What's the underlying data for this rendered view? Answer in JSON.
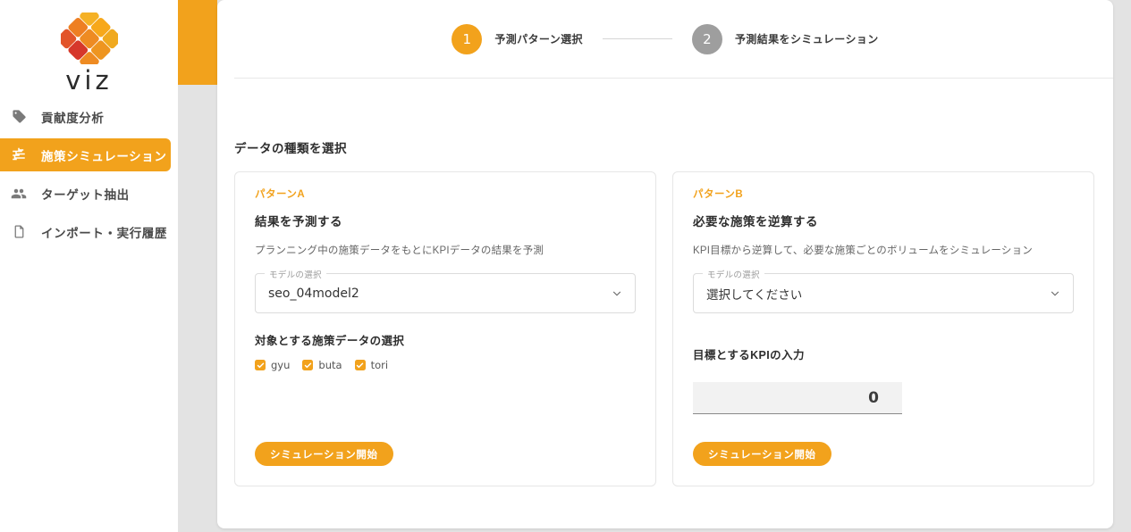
{
  "brand": {
    "logo_icon": "viz-heart-logo-icon",
    "name": "viz",
    "accent": "#F2A21C",
    "accent_dark": "#E06A1E",
    "accent_red": "#D6372B"
  },
  "sidebar": {
    "items": [
      {
        "label": "貢献度分析",
        "icon": "tag-icon",
        "active": false
      },
      {
        "label": "施策シミュレーション",
        "icon": "tune-sliders-icon",
        "active": true
      },
      {
        "label": "ターゲット抽出",
        "icon": "people-group-icon",
        "active": false
      },
      {
        "label": "インポート・実行履歴",
        "icon": "document-file-icon",
        "active": false
      }
    ]
  },
  "stepper": {
    "steps": [
      {
        "number": "1",
        "label": "予測パターン選択",
        "state": "active"
      },
      {
        "number": "2",
        "label": "予測結果をシミュレーション",
        "state": "inactive"
      }
    ]
  },
  "main": {
    "section_title": "データの種類を選択",
    "cards": [
      {
        "kicker": "パターンA",
        "title": "結果を予測する",
        "description": "プランニング中の施策データをもとにKPIデータの結果を予測",
        "select": {
          "legend": "モデルの選択",
          "value": "seo_04model2",
          "chevron_icon": "chevron-down-icon"
        },
        "checkbox_group": {
          "title": "対象とする施策データの選択",
          "options": [
            {
              "label": "gyu",
              "checked": true
            },
            {
              "label": "buta",
              "checked": true
            },
            {
              "label": "tori",
              "checked": true
            }
          ]
        },
        "cta_label": "シミュレーション開始"
      },
      {
        "kicker": "パターンB",
        "title": "必要な施策を逆算する",
        "description": "KPI目標から逆算して、必要な施策ごとのボリュームをシミュレーション",
        "select": {
          "legend": "モデルの選択",
          "value": "選択してください",
          "chevron_icon": "chevron-down-icon"
        },
        "kpi_input": {
          "title": "目標とするKPIの入力",
          "value": "0"
        },
        "cta_label": "シミュレーション開始"
      }
    ]
  }
}
